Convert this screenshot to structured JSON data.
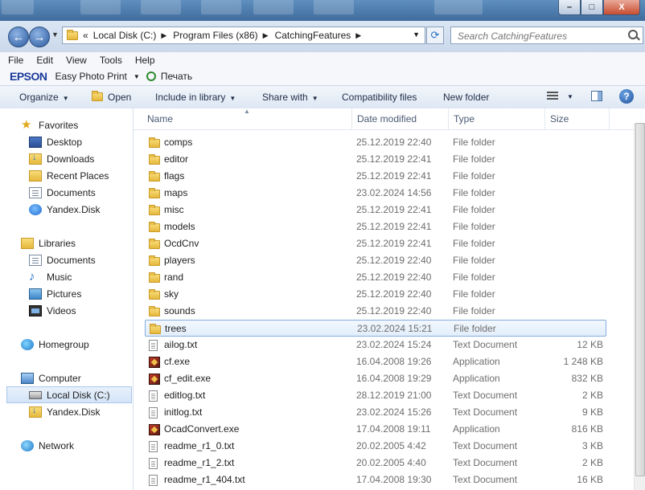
{
  "window": {
    "controls": {
      "minimize": "–",
      "maximize": "□",
      "close": "X"
    }
  },
  "address": {
    "overflow": "«",
    "crumbs": [
      "Local Disk (C:)",
      "Program Files (x86)",
      "CatchingFeatures"
    ],
    "search_placeholder": "Search CatchingFeatures"
  },
  "menu": [
    "File",
    "Edit",
    "View",
    "Tools",
    "Help"
  ],
  "epson": {
    "logo": "EPSON",
    "app": "Easy Photo Print",
    "print": "Печать"
  },
  "toolbar": {
    "organize": "Organize",
    "open": "Open",
    "include": "Include in library",
    "share": "Share with",
    "compat": "Compatibility files",
    "new_folder": "New folder",
    "help": "?"
  },
  "nav": {
    "favorites": "Favorites",
    "desktop": "Desktop",
    "downloads": "Downloads",
    "recent": "Recent Places",
    "documents_fav": "Documents",
    "yandex_fav": "Yandex.Disk",
    "libraries": "Libraries",
    "lib_documents": "Documents",
    "lib_music": "Music",
    "lib_pictures": "Pictures",
    "lib_videos": "Videos",
    "homegroup": "Homegroup",
    "computer": "Computer",
    "local_disk": "Local Disk (C:)",
    "yandex_comp": "Yandex.Disk",
    "network": "Network"
  },
  "columns": {
    "name": "Name",
    "date": "Date modified",
    "type": "Type",
    "size": "Size"
  },
  "files": [
    {
      "name": "comps",
      "date": "25.12.2019 22:40",
      "type": "File folder",
      "size": "",
      "kind": "folder"
    },
    {
      "name": "editor",
      "date": "25.12.2019 22:41",
      "type": "File folder",
      "size": "",
      "kind": "folder"
    },
    {
      "name": "flags",
      "date": "25.12.2019 22:41",
      "type": "File folder",
      "size": "",
      "kind": "folder"
    },
    {
      "name": "maps",
      "date": "23.02.2024 14:56",
      "type": "File folder",
      "size": "",
      "kind": "folder"
    },
    {
      "name": "misc",
      "date": "25.12.2019 22:41",
      "type": "File folder",
      "size": "",
      "kind": "folder"
    },
    {
      "name": "models",
      "date": "25.12.2019 22:41",
      "type": "File folder",
      "size": "",
      "kind": "folder"
    },
    {
      "name": "OcdCnv",
      "date": "25.12.2019 22:41",
      "type": "File folder",
      "size": "",
      "kind": "folder"
    },
    {
      "name": "players",
      "date": "25.12.2019 22:40",
      "type": "File folder",
      "size": "",
      "kind": "folder"
    },
    {
      "name": "rand",
      "date": "25.12.2019 22:40",
      "type": "File folder",
      "size": "",
      "kind": "folder"
    },
    {
      "name": "sky",
      "date": "25.12.2019 22:40",
      "type": "File folder",
      "size": "",
      "kind": "folder"
    },
    {
      "name": "sounds",
      "date": "25.12.2019 22:40",
      "type": "File folder",
      "size": "",
      "kind": "folder"
    },
    {
      "name": "trees",
      "date": "23.02.2024 15:21",
      "type": "File folder",
      "size": "",
      "kind": "folder",
      "selected": true
    },
    {
      "name": "ailog.txt",
      "date": "23.02.2024 15:24",
      "type": "Text Document",
      "size": "12 KB",
      "kind": "text"
    },
    {
      "name": "cf.exe",
      "date": "16.04.2008 19:26",
      "type": "Application",
      "size": "1 248 KB",
      "kind": "exe"
    },
    {
      "name": "cf_edit.exe",
      "date": "16.04.2008 19:29",
      "type": "Application",
      "size": "832 KB",
      "kind": "exe"
    },
    {
      "name": "editlog.txt",
      "date": "28.12.2019 21:00",
      "type": "Text Document",
      "size": "2 KB",
      "kind": "text"
    },
    {
      "name": "initlog.txt",
      "date": "23.02.2024 15:26",
      "type": "Text Document",
      "size": "9 KB",
      "kind": "text"
    },
    {
      "name": "OcadConvert.exe",
      "date": "17.04.2008 19:11",
      "type": "Application",
      "size": "816 KB",
      "kind": "exe"
    },
    {
      "name": "readme_r1_0.txt",
      "date": "20.02.2005 4:42",
      "type": "Text Document",
      "size": "3 KB",
      "kind": "text"
    },
    {
      "name": "readme_r1_2.txt",
      "date": "20.02.2005 4:40",
      "type": "Text Document",
      "size": "2 KB",
      "kind": "text"
    },
    {
      "name": "readme_r1_404.txt",
      "date": "17.04.2008 19:30",
      "type": "Text Document",
      "size": "16 KB",
      "kind": "text"
    }
  ]
}
